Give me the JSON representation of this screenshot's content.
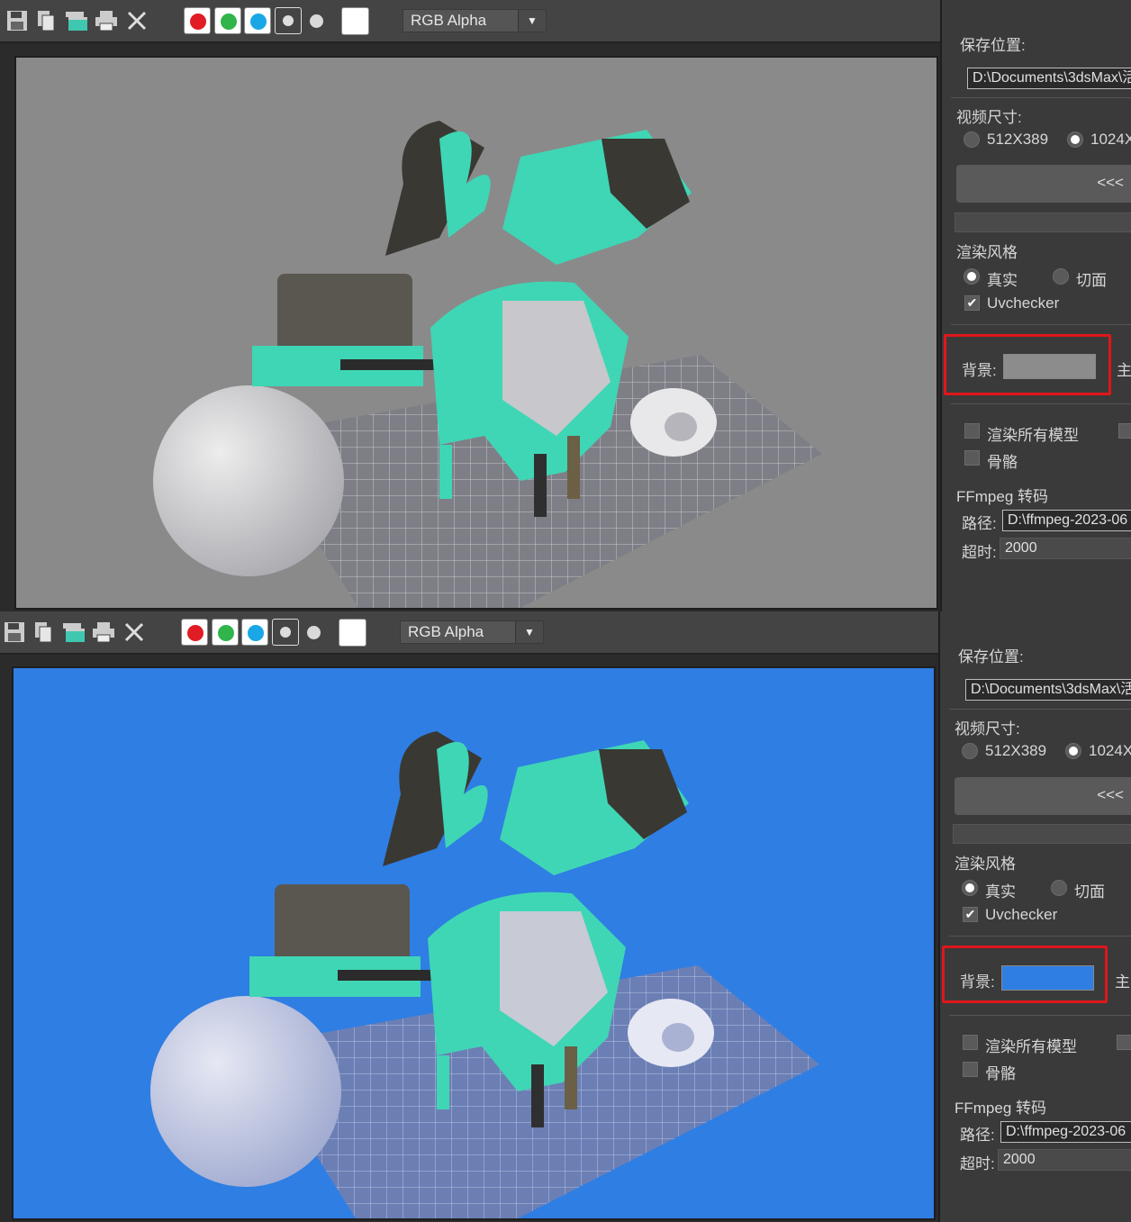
{
  "panels": [
    {
      "id": "gray",
      "toolbar": {
        "channel": "RGB Alpha",
        "icons": [
          "save-icon",
          "copy-icon",
          "clone-window-icon",
          "print-icon",
          "close-icon"
        ],
        "swatches": [
          {
            "name": "red-channel",
            "color": "#e11c24"
          },
          {
            "name": "green-channel",
            "color": "#31b44b"
          },
          {
            "name": "blue-channel",
            "color": "#1aa7e6"
          },
          {
            "name": "mono-toggle",
            "color": "#777777"
          },
          {
            "name": "alpha-dot",
            "color": "#d9d9d9"
          },
          {
            "name": "white-swatch",
            "color": "#ffffff"
          }
        ]
      },
      "viewport_bg": "#8a8a8a",
      "side": {
        "save_label": "保存位置:",
        "save_path": "D:\\Documents\\3dsMax\\活",
        "video_size_label": "视频尺寸:",
        "size_a": "512X389",
        "size_b": "1024X(",
        "back_button": "<<<",
        "render_style_label": "渲染风格",
        "style_real": "真实",
        "style_facet": "切面",
        "uvchecker": "Uvchecker",
        "bg_label": "背景:",
        "bg_color": "#8c8c8c",
        "cut_label": "主",
        "render_all": "渲染所有模型",
        "bones": "骨骼",
        "ffmpeg_label": "FFmpeg 转码",
        "path_label": "路径:",
        "path_value": "D:\\ffmpeg-2023-06",
        "timeout_label": "超时:",
        "timeout_value": "2000"
      }
    },
    {
      "id": "blue",
      "toolbar": {
        "channel": "RGB Alpha",
        "icons": [
          "save-icon",
          "copy-icon",
          "clone-window-icon",
          "print-icon",
          "close-icon"
        ],
        "swatches": [
          {
            "name": "red-channel",
            "color": "#e11c24"
          },
          {
            "name": "green-channel",
            "color": "#31b44b"
          },
          {
            "name": "blue-channel",
            "color": "#1aa7e6"
          },
          {
            "name": "mono-toggle",
            "color": "#777777"
          },
          {
            "name": "alpha-dot",
            "color": "#d9d9d9"
          },
          {
            "name": "white-swatch",
            "color": "#ffffff"
          }
        ]
      },
      "viewport_bg": "#2f7ee3",
      "side": {
        "save_label": "保存位置:",
        "save_path": "D:\\Documents\\3dsMax\\活",
        "video_size_label": "视频尺寸:",
        "size_a": "512X389",
        "size_b": "1024X(",
        "back_button": "<<<",
        "render_style_label": "渲染风格",
        "style_real": "真实",
        "style_facet": "切面",
        "uvchecker": "Uvchecker",
        "bg_label": "背景:",
        "bg_color": "#2f7ee3",
        "cut_label": "主",
        "render_all": "渲染所有模型",
        "bones": "骨骼",
        "ffmpeg_label": "FFmpeg 转码",
        "path_label": "路径:",
        "path_value": "D:\\ffmpeg-2023-06",
        "timeout_label": "超时:",
        "timeout_value": "2000"
      }
    }
  ],
  "colors": {
    "highlight": "#e0161b",
    "teal": "#3fd6b5"
  }
}
